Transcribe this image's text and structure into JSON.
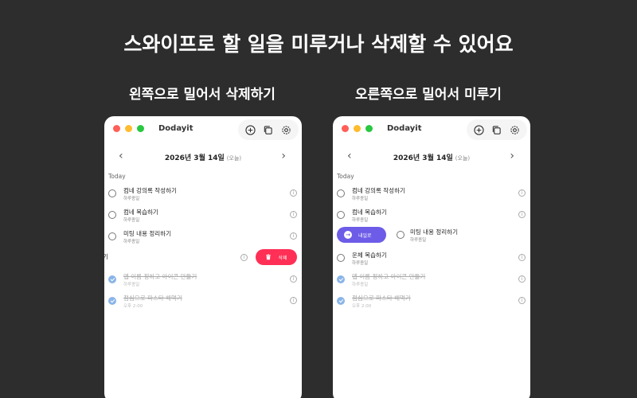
{
  "headline": "스와이프로 할 일을 미루거나 삭제할 수 있어요",
  "left_panel": {
    "subtitle": "왼쪽으로 밀어서 삭제하기",
    "app_title": "Dodayit",
    "date": "2026년 3월 14일",
    "date_tag": "(오늘)",
    "section": "Today",
    "tasks": [
      {
        "title": "컴네 강의록 작성하기",
        "meta": "하루종일"
      },
      {
        "title": "컴네 복습하기",
        "meta": "하루종일"
      },
      {
        "title": "미팅 내용 정리하기",
        "meta": "하루종일"
      }
    ],
    "swiped_task_fragment": "기",
    "delete_label": "삭제",
    "completed": [
      {
        "title": "앱 이름 정하고 아이콘 만들기",
        "meta": "하루종일"
      },
      {
        "title": "점심으로 파스타 해먹기",
        "meta": "오후 2:00"
      }
    ]
  },
  "right_panel": {
    "subtitle": "오른쪽으로 밀어서 미루기",
    "app_title": "Dodayit",
    "date": "2026년 3월 14일",
    "date_tag": "(오늘)",
    "section": "Today",
    "tasks": [
      {
        "title": "컴네 강의록 작성하기",
        "meta": "하루종일"
      },
      {
        "title": "컴네 복습하기",
        "meta": "하루종일"
      }
    ],
    "postpone_label": "내일로",
    "swiped_task": {
      "title": "미팅 내용 정리하기",
      "meta": "하루종일"
    },
    "tasks_after": [
      {
        "title": "운체 복습하기",
        "meta": "하루종일"
      }
    ],
    "completed": [
      {
        "title": "앱 이름 정하고 아이콘 만들기",
        "meta": "하루종일"
      },
      {
        "title": "점심으로 파스타 해먹기",
        "meta": "오후 2:00"
      }
    ]
  },
  "icons": {
    "add": "plus-circle-icon",
    "copy": "copy-icon",
    "settings": "gear-icon",
    "info": "info-icon",
    "trash": "trash-icon",
    "arrow": "arrow-right-icon"
  },
  "colors": {
    "background": "#2d2d2d",
    "delete": "#ff2f55",
    "postpone": "#6c5ce7",
    "done_check": "#8ab4e8"
  },
  "glyphs": {
    "chev_prev": "‹",
    "chev_next": "›",
    "info": "i",
    "arrow": "→"
  }
}
